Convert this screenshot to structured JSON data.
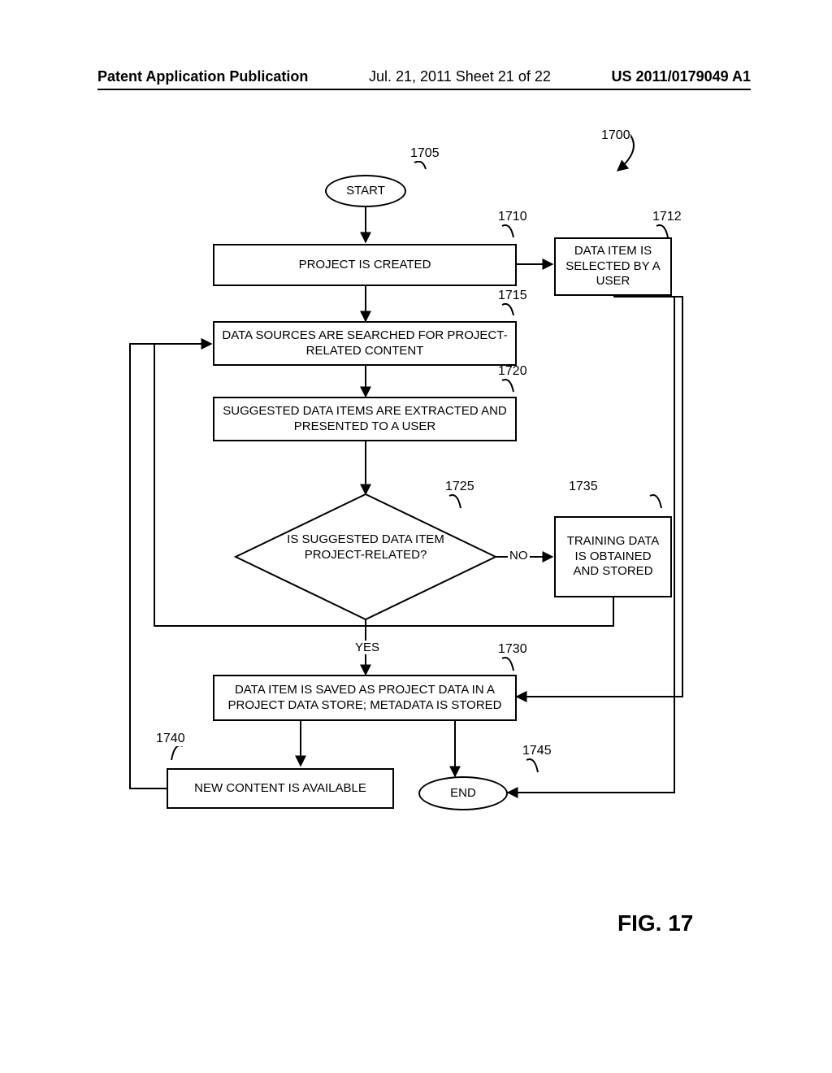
{
  "header": {
    "left": "Patent Application Publication",
    "center": "Jul. 21, 2011  Sheet 21 of 22",
    "right": "US 2011/0179049 A1"
  },
  "refs": {
    "start": "1705",
    "overall": "1700",
    "project_created": "1710",
    "data_item_selected": "1712",
    "search_sources": "1715",
    "suggest_extract": "1720",
    "decision": "1725",
    "training": "1735",
    "save_data": "1730",
    "new_content": "1740",
    "end": "1745"
  },
  "nodes": {
    "start": "START",
    "project_created": "PROJECT IS CREATED",
    "data_item_selected": "DATA ITEM IS SELECTED BY A USER",
    "search_sources": "DATA SOURCES ARE SEARCHED FOR PROJECT-RELATED CONTENT",
    "suggest_extract": "SUGGESTED DATA ITEMS ARE EXTRACTED AND PRESENTED TO A USER",
    "decision": "IS SUGGESTED DATA ITEM PROJECT-RELATED?",
    "training": "TRAINING DATA IS OBTAINED AND STORED",
    "save_data": "DATA ITEM IS SAVED AS PROJECT DATA IN A PROJECT DATA STORE; METADATA IS STORED",
    "new_content": "NEW CONTENT IS AVAILABLE",
    "end": "END"
  },
  "edges": {
    "yes": "YES",
    "no": "NO"
  },
  "figure": "FIG. 17"
}
